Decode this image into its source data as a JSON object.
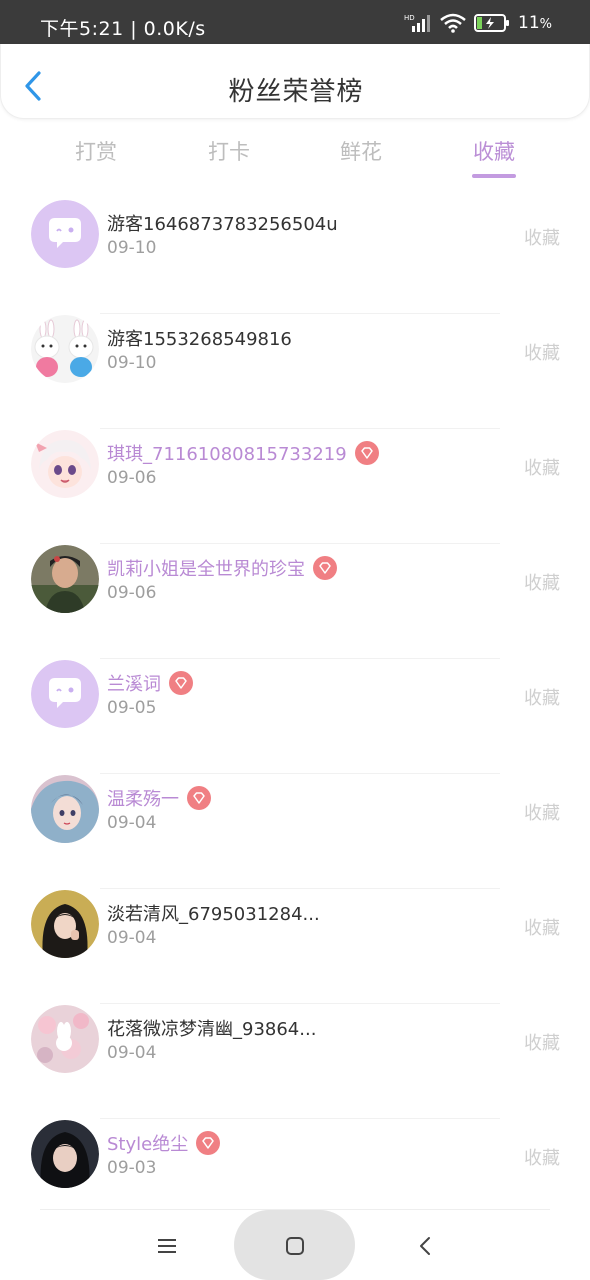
{
  "status_bar": {
    "time": "下午5:21 | 0.0K/s",
    "battery": "11"
  },
  "header": {
    "title": "粉丝荣誉榜"
  },
  "tabs": [
    {
      "label": "打赏"
    },
    {
      "label": "打卡"
    },
    {
      "label": "鲜花"
    },
    {
      "label": "收藏",
      "active": true
    }
  ],
  "rows": [
    {
      "name": "游客1646873783256504u",
      "date": "09-10",
      "action": "收藏",
      "vip": false,
      "avatar": "default-chat-avatar"
    },
    {
      "name": "游客1553268549816",
      "date": "09-10",
      "action": "收藏",
      "vip": false,
      "avatar": "bunny-avatar"
    },
    {
      "name": "琪琪_71161080815733219",
      "date": "09-06",
      "action": "收藏",
      "vip": true,
      "avatar": "anime-girl-avatar"
    },
    {
      "name": "凯莉小姐是全世界的珍宝",
      "date": "09-06",
      "action": "收藏",
      "vip": true,
      "avatar": "photo-avatar"
    },
    {
      "name": "兰溪词",
      "date": "09-05",
      "action": "收藏",
      "vip": true,
      "avatar": "default-chat-avatar"
    },
    {
      "name": "温柔殇一",
      "date": "09-04",
      "action": "收藏",
      "vip": true,
      "avatar": "anime-portrait-avatar"
    },
    {
      "name": "淡若清风_6795031284...",
      "date": "09-04",
      "action": "收藏",
      "vip": false,
      "avatar": "photo-avatar"
    },
    {
      "name": "花落微凉梦清幽_93864...",
      "date": "09-04",
      "action": "收藏",
      "vip": false,
      "avatar": "floral-avatar"
    },
    {
      "name": "Style绝尘",
      "date": "09-03",
      "action": "收藏",
      "vip": true,
      "avatar": "photo-avatar"
    }
  ],
  "colors": {
    "accent": "#bb8fd6",
    "vip_badge": "#f07f83",
    "muted": "#cfcfcf"
  }
}
